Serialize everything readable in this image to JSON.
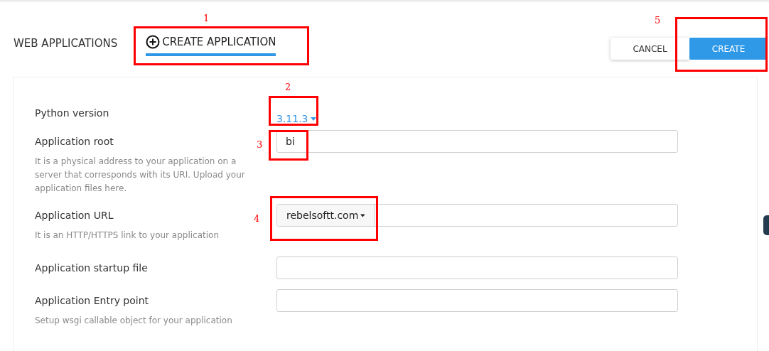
{
  "header": {
    "title": "WEB APPLICATIONS",
    "tab": {
      "label": "CREATE APPLICATION",
      "selected": true
    },
    "buttons": [
      {
        "kind": "secondary",
        "label": "CANCEL"
      },
      {
        "kind": "primary",
        "label": "CREATE"
      }
    ]
  },
  "form": {
    "rows": [
      {
        "kind": "dropdown",
        "label": "Python version",
        "value": "3.11.3"
      },
      {
        "kind": "input",
        "label": "Application root",
        "value": "bi",
        "help": "It is a physical address to your application on a server that corresponds with its URI. Upload your application files here."
      },
      {
        "kind": "url",
        "label": "Application URL",
        "domain": "rebelsoftt.com",
        "help": "It is an HTTP/HTTPS link to your application"
      },
      {
        "kind": "input",
        "label": "Application startup file"
      },
      {
        "kind": "input",
        "label": "Application Entry point",
        "help": "Setup wsgi callable object for your application"
      }
    ]
  },
  "annotations": [
    "1",
    "2",
    "3",
    "4",
    "5"
  ]
}
